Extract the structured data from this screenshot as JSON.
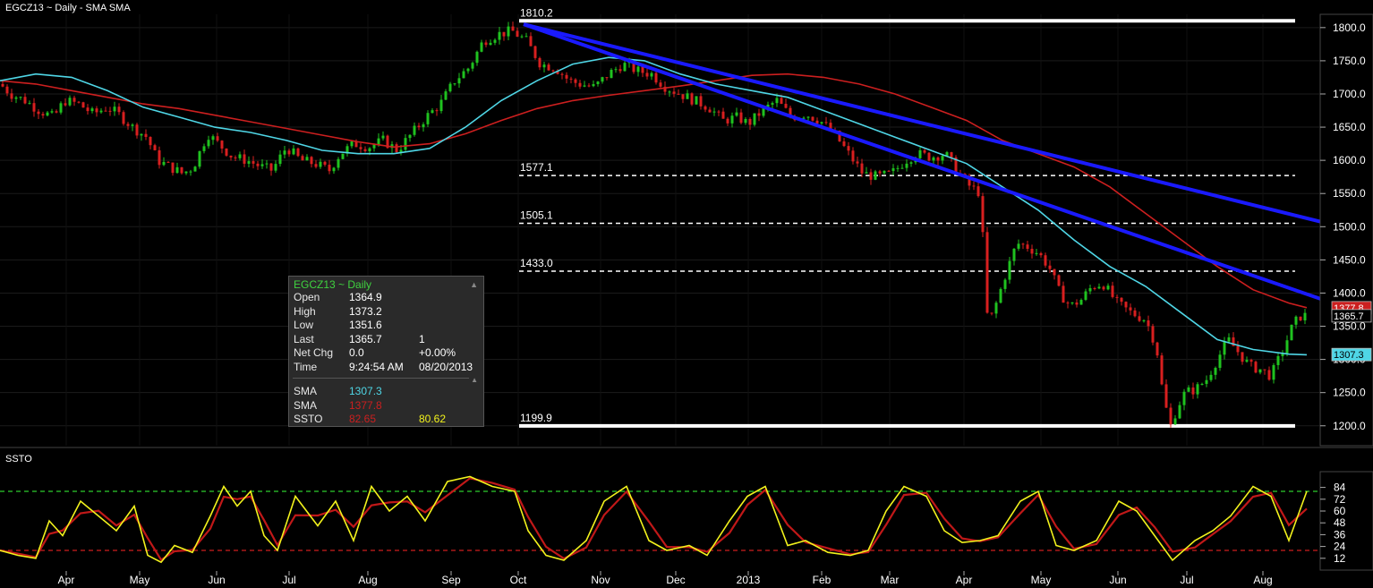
{
  "window": {
    "title": "EGCZ13 ~ Daily  -  SMA SMA",
    "subchart_title": "SSTO"
  },
  "info_panel": {
    "header": "EGCZ13 ~ Daily",
    "rows": [
      {
        "label": "Open",
        "value": "1364.9",
        "extra": ""
      },
      {
        "label": "High",
        "value": "1373.2",
        "extra": ""
      },
      {
        "label": "Low",
        "value": "1351.6",
        "extra": ""
      },
      {
        "label": "Last",
        "value": "1365.7",
        "extra": "1"
      },
      {
        "label": "Net Chg",
        "value": "0.0",
        "extra": "+0.00%"
      },
      {
        "label": "Time",
        "value": "9:24:54 AM",
        "extra": "08/20/2013"
      }
    ],
    "indicators": [
      {
        "label": "SMA",
        "value": "1307.3",
        "extra": "",
        "color": "#4fd6e6"
      },
      {
        "label": "SMA",
        "value": "1377.8",
        "extra": "",
        "color": "#cc1f1f"
      },
      {
        "label": "SSTO",
        "value": "82.65",
        "extra": "80.62",
        "color": "#cc1f1f",
        "extra_color": "#f2f21c"
      }
    ]
  },
  "chart_data": [
    {
      "type": "candlestick",
      "title": "EGCZ13 ~ Daily  -  SMA SMA",
      "ylim": [
        1170,
        1820
      ],
      "y_ticks": [
        1200,
        1250,
        1300,
        1350,
        1400,
        1450,
        1500,
        1550,
        1600,
        1650,
        1700,
        1750,
        1800
      ],
      "y_tick_labels": [
        "1200.0",
        "1250.0",
        "1300.0",
        "1350.0",
        "1400.0",
        "1450.0",
        "1500.0",
        "1550.0",
        "1600.0",
        "1650.0",
        "1700.0",
        "1750.0",
        "1800.0"
      ],
      "x_months": [
        "Apr",
        "May",
        "Jun",
        "Jul",
        "Aug",
        "Sep",
        "Oct",
        "Nov",
        "Dec",
        "2013",
        "Feb",
        "Mar",
        "Apr",
        "May",
        "Jun",
        "Jul",
        "Aug"
      ],
      "price_series": {
        "x": [
          0,
          12,
          28,
          44,
          60,
          72,
          88,
          104,
          120,
          132,
          148,
          164,
          176,
          190,
          204,
          216,
          232,
          248,
          260,
          276,
          292,
          304,
          320,
          336,
          352,
          368,
          380,
          396,
          412,
          428,
          444,
          460,
          476,
          492,
          508,
          524,
          540,
          556,
          572,
          588,
          604,
          620,
          636,
          648,
          664,
          680,
          696,
          712,
          728,
          744,
          760,
          776,
          792,
          808,
          824,
          836,
          852,
          868,
          884,
          900,
          916,
          932,
          948,
          964,
          980,
          996,
          1012,
          1024,
          1040,
          1056,
          1072,
          1084,
          1096,
          1100,
          1104,
          1112,
          1124,
          1136,
          1148,
          1160,
          1172,
          1184,
          1196,
          1208,
          1220,
          1232,
          1248,
          1264,
          1280,
          1292,
          1300,
          1308,
          1316,
          1324,
          1336,
          1348,
          1360,
          1372,
          1384,
          1396,
          1408,
          1420,
          1432,
          1444,
          1452,
          1460
        ],
        "y": [
          1715,
          1700,
          1690,
          1675,
          1665,
          1690,
          1685,
          1670,
          1680,
          1670,
          1650,
          1635,
          1600,
          1590,
          1580,
          1590,
          1640,
          1620,
          1605,
          1600,
          1590,
          1585,
          1620,
          1600,
          1595,
          1585,
          1610,
          1625,
          1620,
          1630,
          1615,
          1640,
          1665,
          1685,
          1720,
          1740,
          1780,
          1790,
          1795,
          1780,
          1745,
          1740,
          1720,
          1715,
          1710,
          1730,
          1745,
          1735,
          1730,
          1710,
          1700,
          1690,
          1680,
          1660,
          1665,
          1655,
          1675,
          1690,
          1665,
          1670,
          1660,
          1640,
          1610,
          1580,
          1575,
          1580,
          1600,
          1610,
          1605,
          1610,
          1580,
          1560,
          1550,
          1420,
          1350,
          1380,
          1430,
          1475,
          1470,
          1460,
          1440,
          1400,
          1380,
          1390,
          1410,
          1415,
          1385,
          1370,
          1360,
          1320,
          1240,
          1200,
          1230,
          1250,
          1255,
          1270,
          1300,
          1330,
          1310,
          1290,
          1285,
          1275,
          1310,
          1350,
          1365,
          1366
        ]
      },
      "sma_fast": {
        "color": "#4fd6e6",
        "x": [
          0,
          40,
          80,
          120,
          160,
          200,
          240,
          280,
          320,
          360,
          400,
          440,
          480,
          520,
          560,
          600,
          640,
          680,
          720,
          760,
          800,
          840,
          880,
          920,
          960,
          1000,
          1040,
          1080,
          1120,
          1160,
          1200,
          1240,
          1280,
          1320,
          1360,
          1400,
          1440,
          1460
        ],
        "y": [
          1720,
          1730,
          1725,
          1705,
          1680,
          1665,
          1650,
          1642,
          1630,
          1615,
          1610,
          1610,
          1618,
          1650,
          1690,
          1720,
          1745,
          1755,
          1750,
          1730,
          1715,
          1705,
          1695,
          1675,
          1655,
          1635,
          1615,
          1595,
          1560,
          1525,
          1480,
          1440,
          1410,
          1370,
          1330,
          1315,
          1308,
          1307
        ]
      },
      "sma_slow": {
        "color": "#cc1f1f",
        "x": [
          0,
          40,
          80,
          120,
          160,
          200,
          240,
          280,
          320,
          360,
          400,
          440,
          480,
          520,
          560,
          600,
          640,
          680,
          720,
          760,
          800,
          840,
          880,
          920,
          960,
          1000,
          1040,
          1080,
          1120,
          1160,
          1200,
          1240,
          1280,
          1320,
          1360,
          1400,
          1440,
          1460
        ],
        "y": [
          1720,
          1715,
          1705,
          1695,
          1685,
          1678,
          1668,
          1658,
          1648,
          1638,
          1628,
          1620,
          1625,
          1640,
          1660,
          1678,
          1690,
          1698,
          1705,
          1712,
          1720,
          1728,
          1730,
          1725,
          1715,
          1700,
          1680,
          1660,
          1630,
          1610,
          1590,
          1560,
          1520,
          1480,
          1440,
          1405,
          1385,
          1378
        ]
      },
      "trendlines": [
        {
          "from": [
            585,
            1805
          ],
          "to": [
            1534,
            1488
          ]
        },
        {
          "from": [
            585,
            1805
          ],
          "to": [
            1534,
            1364
          ]
        }
      ],
      "levels": [
        {
          "value": 1810.2,
          "label": "1810.2",
          "style": "solid"
        },
        {
          "value": 1577.1,
          "label": "1577.1",
          "style": "dashed"
        },
        {
          "value": 1505.1,
          "label": "1505.1",
          "style": "dashed"
        },
        {
          "value": 1433.0,
          "label": "1433.0",
          "style": "dashed"
        },
        {
          "value": 1199.9,
          "label": "1199.9",
          "style": "solid"
        }
      ],
      "price_badges": [
        {
          "label": "1377.8",
          "value": 1377.8,
          "color": "#cc1f1f",
          "text_color": "#ffffff"
        },
        {
          "label": "1365.7",
          "value": 1365.7,
          "color": "#000000",
          "text_color": "#ffffff"
        },
        {
          "label": "1307.3",
          "value": 1307.3,
          "color": "#4fd6e6",
          "text_color": "#000000"
        }
      ]
    },
    {
      "type": "line",
      "title": "SSTO",
      "ylim": [
        0,
        100
      ],
      "y_ticks": [
        12,
        24,
        36,
        48,
        60,
        72,
        84
      ],
      "y_tick_labels": [
        "12",
        "24",
        "36",
        "48",
        "60",
        "72",
        "84"
      ],
      "levels": [
        {
          "value": 80,
          "color": "#2ecc2e"
        },
        {
          "value": 20,
          "color": "#cc1f1f"
        }
      ],
      "series": [
        {
          "color": "#f2f21c",
          "x": [
            0,
            20,
            40,
            55,
            70,
            90,
            110,
            130,
            150,
            165,
            180,
            195,
            215,
            235,
            250,
            265,
            280,
            295,
            310,
            330,
            355,
            375,
            395,
            415,
            435,
            455,
            475,
            500,
            525,
            550,
            575,
            590,
            610,
            630,
            655,
            675,
            700,
            725,
            745,
            770,
            790,
            815,
            835,
            855,
            880,
            900,
            925,
            950,
            970,
            990,
            1010,
            1035,
            1055,
            1075,
            1095,
            1115,
            1140,
            1160,
            1180,
            1200,
            1225,
            1250,
            1270,
            1290,
            1310,
            1335,
            1355,
            1375,
            1400,
            1420,
            1440,
            1460
          ],
          "y": [
            20,
            15,
            12,
            50,
            35,
            70,
            55,
            40,
            65,
            15,
            8,
            25,
            18,
            55,
            85,
            65,
            80,
            35,
            20,
            75,
            45,
            70,
            30,
            85,
            60,
            75,
            50,
            90,
            95,
            85,
            80,
            40,
            15,
            10,
            30,
            70,
            85,
            30,
            20,
            25,
            15,
            50,
            75,
            85,
            25,
            30,
            18,
            15,
            20,
            60,
            85,
            75,
            40,
            28,
            30,
            35,
            70,
            80,
            25,
            20,
            30,
            70,
            60,
            35,
            10,
            30,
            40,
            55,
            85,
            75,
            30,
            80
          ]
        }
      ]
    }
  ]
}
